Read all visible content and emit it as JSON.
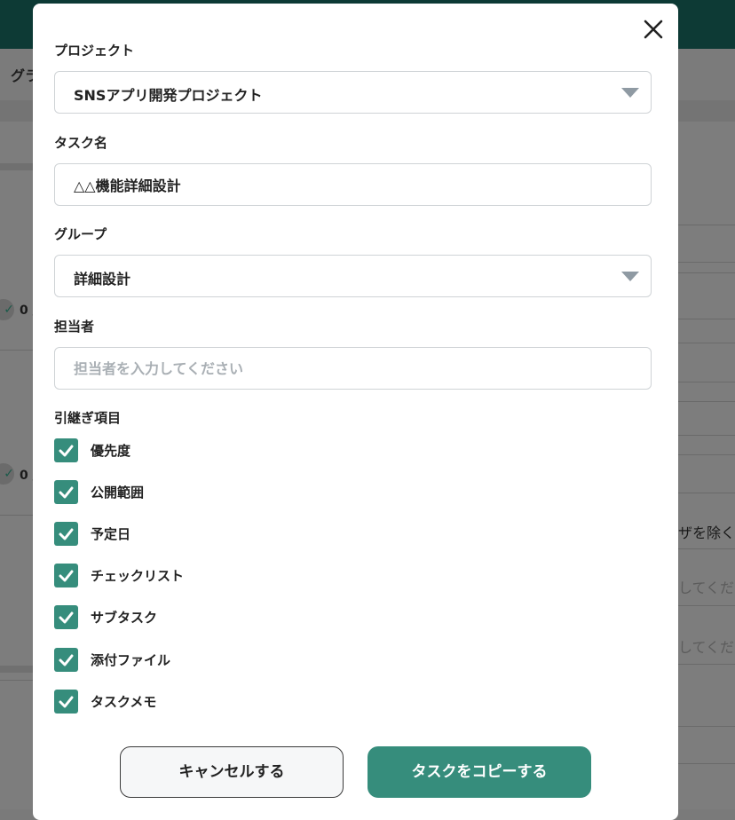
{
  "background": {
    "bar_text": "グラ",
    "count_text": "0 /",
    "right_text": "ザを除く",
    "right_hint": "してくだ"
  },
  "modal": {
    "project": {
      "label": "プロジェクト",
      "value": "SNSアプリ開発プロジェクト"
    },
    "task_name": {
      "label": "タスク名",
      "value": "△△機能詳細設計"
    },
    "group": {
      "label": "グループ",
      "value": "詳細設計"
    },
    "assignee": {
      "label": "担当者",
      "placeholder": "担当者を入力してください",
      "value": ""
    },
    "inherit": {
      "label": "引継ぎ項目",
      "items": [
        {
          "label": "優先度",
          "checked": true
        },
        {
          "label": "公開範囲",
          "checked": true
        },
        {
          "label": "予定日",
          "checked": true
        },
        {
          "label": "チェックリスト",
          "checked": true
        },
        {
          "label": "サブタスク",
          "checked": true
        },
        {
          "label": "添付ファイル",
          "checked": true
        },
        {
          "label": "タスクメモ",
          "checked": true
        }
      ]
    },
    "buttons": {
      "cancel": "キャンセルする",
      "copy": "タスクをコピーする"
    }
  },
  "colors": {
    "accent": "#368d7c",
    "header": "#0d3a35",
    "overlay": "#7d7d7d"
  }
}
